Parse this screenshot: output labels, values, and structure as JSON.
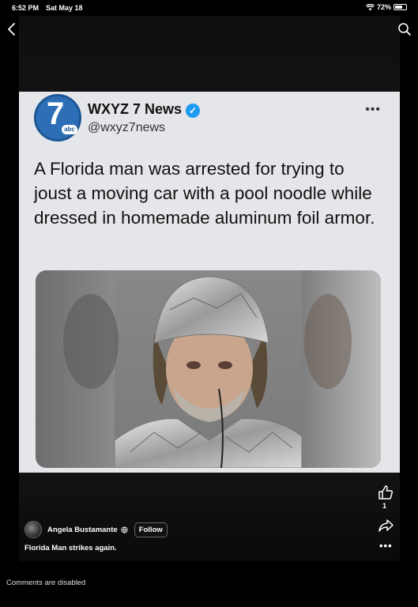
{
  "status_bar": {
    "time": "6:52 PM",
    "date": "Sat May 18",
    "battery_percent": "72%",
    "battery_level": 0.72
  },
  "tweet": {
    "account_name": "WXYZ 7 News",
    "handle": "@wxyz7news",
    "logo_text": "7",
    "logo_badge": "abc",
    "text": "A Florida man was arrested for trying to joust a moving car with a pool noodle while dressed in homemade aluminum foil armor."
  },
  "post": {
    "author": "Angela Bustamante",
    "follow_label": "Follow",
    "caption": "Florida Man strikes again.",
    "like_count": "1"
  },
  "footer": {
    "comments": "Comments are disabled"
  },
  "icons": {
    "back": "chevron-left-icon",
    "search": "search-icon",
    "like": "thumbs-up-icon",
    "share": "share-icon",
    "more": "more-dots-icon",
    "wifi": "wifi-icon",
    "battery": "battery-icon",
    "verified": "verified-badge-icon",
    "globe": "globe-icon"
  },
  "colors": {
    "verified": "#1d9bf0",
    "logo_blue": "#2d6fb6",
    "card_bg": "#e4e6e9"
  }
}
